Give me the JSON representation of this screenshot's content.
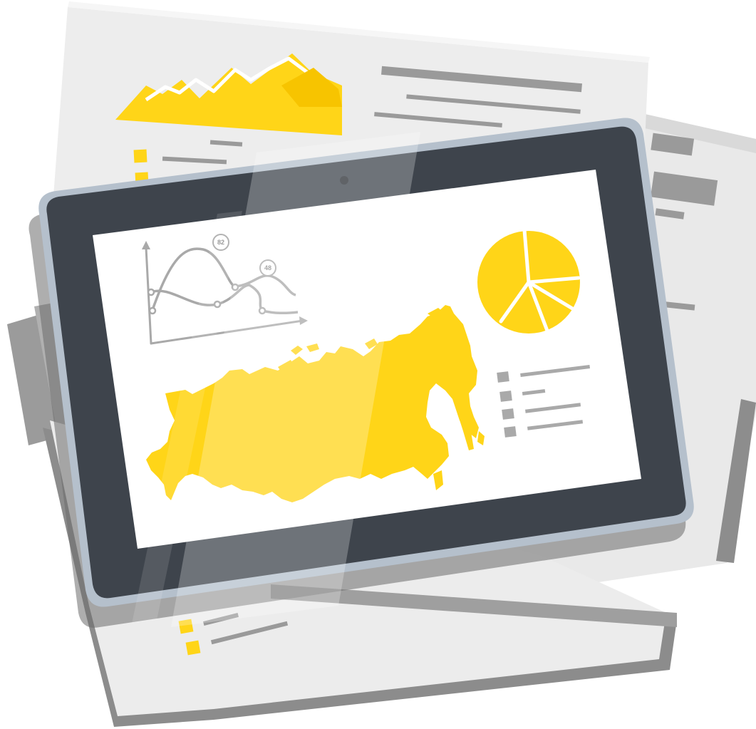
{
  "illustration": {
    "colors": {
      "accent_yellow": "#FFD518",
      "tablet_frame": "#3E444C",
      "tablet_rim": "#B5C0CC",
      "paper": "#EFEFEF",
      "paper_shadow": "#8E8E8E",
      "chart_gray": "#A9A9A9"
    },
    "line_chart": {
      "callouts": [
        {
          "label": "82"
        },
        {
          "label": "48"
        }
      ]
    },
    "icons": {
      "camera": "camera-icon",
      "map": "russia-map-icon",
      "pie": "pie-chart-icon",
      "line": "line-chart-icon",
      "mountain": "area-chart-icon"
    }
  }
}
